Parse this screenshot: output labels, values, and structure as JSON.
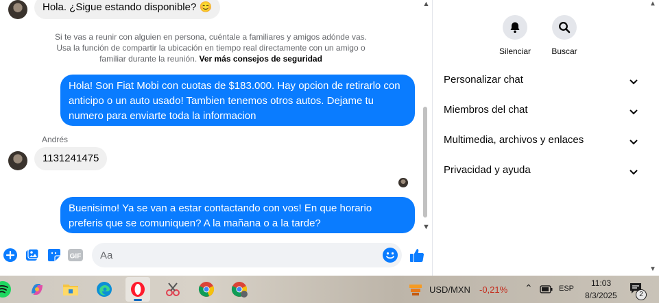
{
  "messages": {
    "top_incoming": "Hola. ¿Sigue estando disponible? 😊",
    "notice_text": "Si te vas a reunir con alguien en persona, cuéntale a familiares y amigos adónde vas. Usa la función de compartir la ubicación en tiempo real directamente con un amigo o familiar durante la reunión.",
    "notice_link": "Ver más consejos de seguridad",
    "outgoing_1": "Hola! Son Fiat Mobi con cuotas de $183.000. Hay opcion de retirarlo con anticipo o un auto usado! Tambien tenemos otros autos. Dejame tu numero para enviarte toda la informacion",
    "sender_name": "Andrés",
    "incoming_2": "1131241475",
    "outgoing_2": "Buenisimo! Ya se van a estar contactando con vos! En que horario preferis que se comuniquen? A la mañana o a la tarde?"
  },
  "composer": {
    "placeholder": "Aa",
    "icons": [
      "plus-circle-icon",
      "image-icon",
      "sticker-icon",
      "gif-icon",
      "emoji-icon",
      "thumbs-up-icon"
    ],
    "gif_label": "GIF"
  },
  "panel": {
    "mute_label": "Silenciar",
    "search_label": "Buscar",
    "sections": [
      "Personalizar chat",
      "Miembros del chat",
      "Multimedia, archivos y enlaces",
      "Privacidad y ayuda"
    ]
  },
  "taskbar": {
    "currency_pair": "USD/MXN",
    "currency_change": "-0,21%",
    "language": "ESP",
    "time": "11:03",
    "date": "8/3/2025",
    "notification_count": "2"
  },
  "colors": {
    "accent": "#0a7cff",
    "negative": "#c42b1c"
  }
}
